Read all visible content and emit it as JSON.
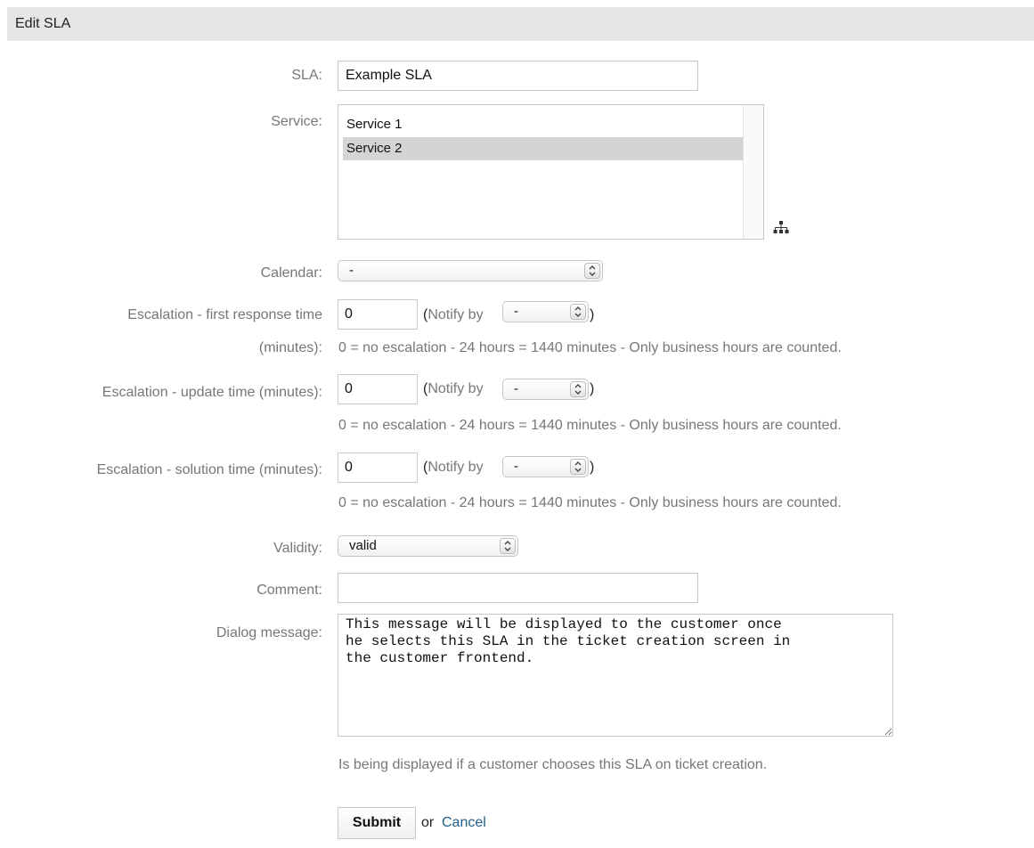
{
  "header": {
    "title": "Edit SLA"
  },
  "form": {
    "sla": {
      "label": "SLA:",
      "value": "Example SLA"
    },
    "service": {
      "label": "Service:",
      "options": [
        "Service 1",
        "Service 2"
      ],
      "selected": "Service 2",
      "tree_icon": "sitemap-icon"
    },
    "calendar": {
      "label": "Calendar:",
      "value": "-"
    },
    "first_response": {
      "label_line1": "Escalation - first response time",
      "label_line2": "(minutes):",
      "value": "0",
      "notify_open": "(",
      "notify_label": "Notify by",
      "notify_value": "-",
      "notify_close": ")",
      "hint": "0 = no escalation - 24 hours = 1440 minutes - Only business hours are counted."
    },
    "update": {
      "label": "Escalation - update time (minutes):",
      "value": "0",
      "notify_open": "(",
      "notify_label": "Notify by",
      "notify_value": "-",
      "notify_close": ")",
      "hint": "0 = no escalation - 24 hours = 1440 minutes - Only business hours are counted."
    },
    "solution": {
      "label": "Escalation - solution time (minutes):",
      "value": "0",
      "notify_open": "(",
      "notify_label": "Notify by",
      "notify_value": "-",
      "notify_close": ")",
      "hint": "0 = no escalation - 24 hours = 1440 minutes - Only business hours are counted."
    },
    "validity": {
      "label": "Validity:",
      "value": "valid"
    },
    "comment": {
      "label": "Comment:",
      "value": ""
    },
    "dialog": {
      "label": "Dialog message:",
      "value": "This message will be displayed to the customer once\nhe selects this SLA in the ticket creation screen in\nthe customer frontend.",
      "hint": "Is being displayed if a customer chooses this SLA on ticket creation."
    }
  },
  "actions": {
    "submit": "Submit",
    "or": "or",
    "cancel": "Cancel"
  }
}
